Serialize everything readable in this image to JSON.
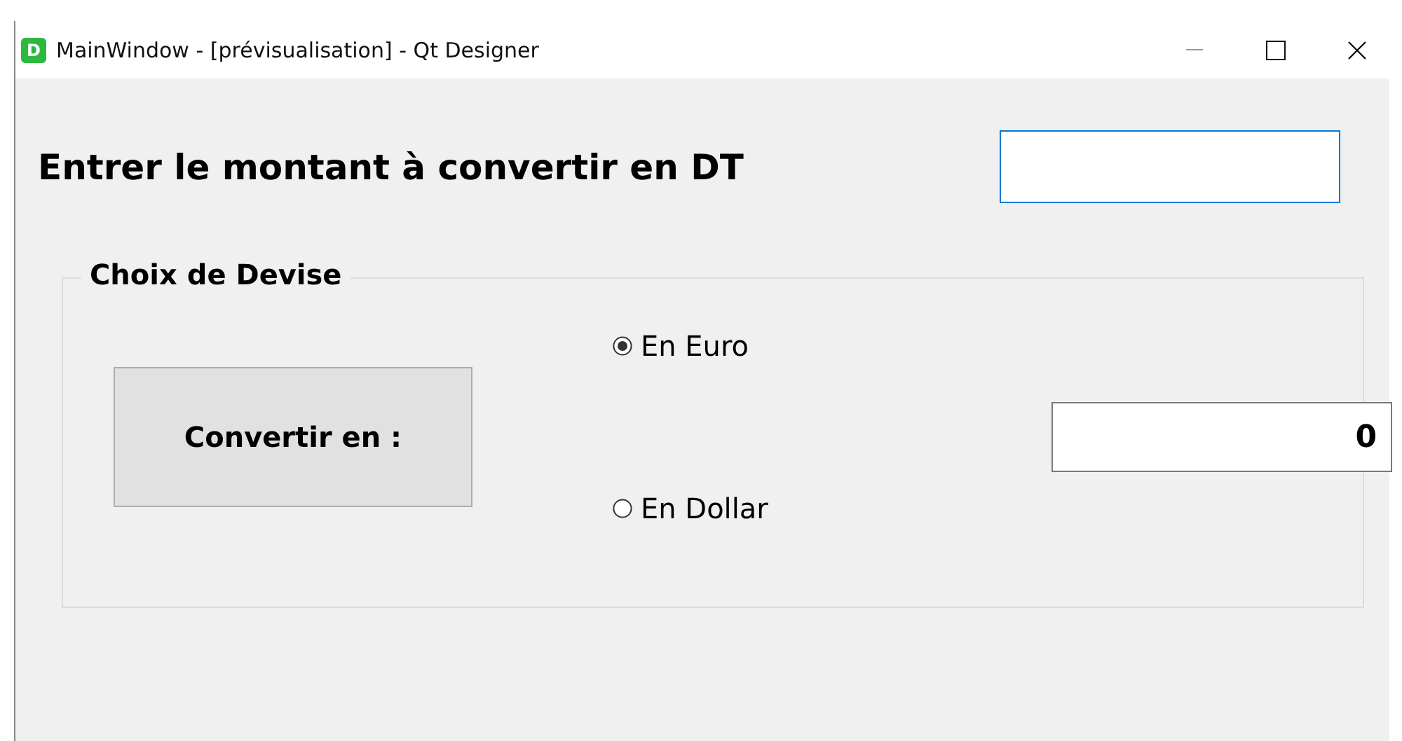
{
  "window": {
    "title": "MainWindow - [prévisualisation] - Qt Designer",
    "app_icon_letter": "D"
  },
  "amount": {
    "label": "Entrer le montant à convertir en DT"
  },
  "group": {
    "title": "Choix de Devise",
    "button": "Convertir en :",
    "options": [
      {
        "label": "En Euro",
        "selected": true
      },
      {
        "label": "En Dollar",
        "selected": false
      }
    ],
    "result": "0"
  }
}
